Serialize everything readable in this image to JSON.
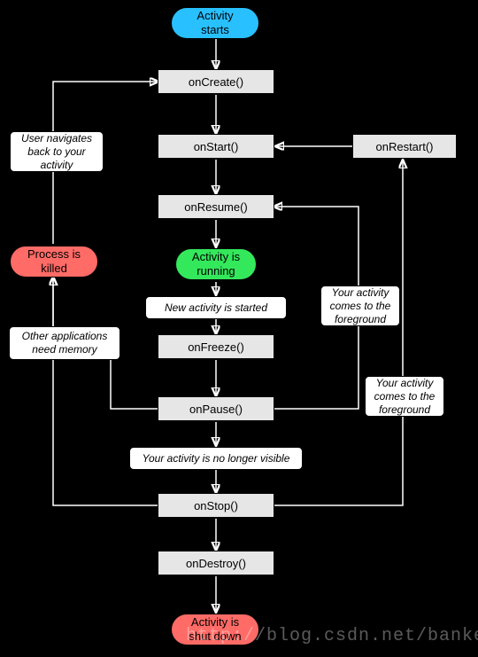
{
  "colors": {
    "blue": "#29c0ff",
    "green": "#34e85b",
    "red": "#ff6b66",
    "grey": "#e6e6e6",
    "white": "#ffffff"
  },
  "nodes": {
    "start": "Activity\nstarts",
    "onCreate": "onCreate()",
    "onStart": "onStart()",
    "onResume": "onResume()",
    "onRestart": "onRestart()",
    "running": "Activity is\nrunning",
    "killed": "Process is\nkilled",
    "newActivity": "New activity is started",
    "onFreeze": "onFreeze()",
    "onPause": "onPause()",
    "noLongerVisible": "Your activity is no longer visible",
    "onStop": "onStop()",
    "onDestroy": "onDestroy()",
    "shutdown": "Activity is\nshut down",
    "navigateBack": "User navigates\nback to your\nactivity",
    "needMemory": "Other applications\nneed memory",
    "foreground1": "Your activity\ncomes to the\nforeground",
    "foreground2": "Your activity\ncomes to the\nforeground"
  },
  "watermark": "http://blog.csdn.net/banketree"
}
